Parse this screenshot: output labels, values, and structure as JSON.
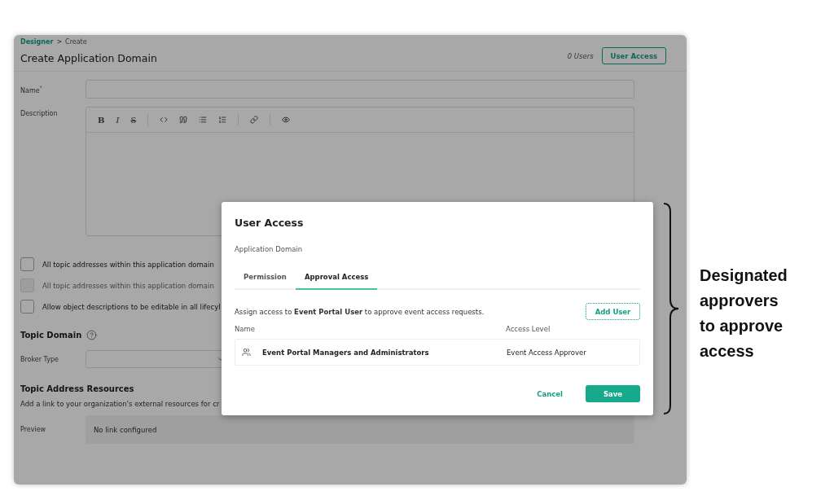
{
  "breadcrumb": {
    "items": [
      {
        "label": "Designer",
        "link": true
      },
      {
        "label": "Create",
        "link": false
      }
    ],
    "separator": ">"
  },
  "page_title": "Create Application Domain",
  "users_count": "0 Users",
  "user_access_button": "User Access",
  "form": {
    "name_label": "Name",
    "required_mark": "*",
    "description_label": "Description",
    "format_buttons": [
      "B",
      "I",
      "S"
    ],
    "checkboxes": [
      {
        "label": "All topic addresses within this application domain",
        "checked": false,
        "disabled": false
      },
      {
        "label": "All topic addresses within this application domain",
        "checked": false,
        "disabled": true
      },
      {
        "label": "Allow object descriptions to be editable in all lifecyl",
        "checked": false,
        "disabled": false
      }
    ]
  },
  "topic_domain": {
    "heading": "Topic Domain",
    "broker_type_label": "Broker Type"
  },
  "resources": {
    "heading": "Topic Address Resources",
    "hint": "Add a link to your organization's external resources for cr",
    "preview_label": "Preview",
    "preview_value": "No link configured"
  },
  "modal": {
    "title": "User Access",
    "subtitle": "Application Domain",
    "tabs": [
      {
        "label": "Permission",
        "selected": false
      },
      {
        "label": "Approval Access",
        "selected": true
      }
    ],
    "description": "Assign access to **Event Portal User** to approve event access requests.",
    "add_button": "Add User",
    "columns": [
      "Name",
      "Access Level"
    ],
    "rows": [
      {
        "name": "Event Portal Managers and Administrators",
        "access_level": "Event Access Approver"
      }
    ],
    "cancel": "Cancel",
    "save": "Save"
  },
  "annotation": "Designated approvers to approve access"
}
